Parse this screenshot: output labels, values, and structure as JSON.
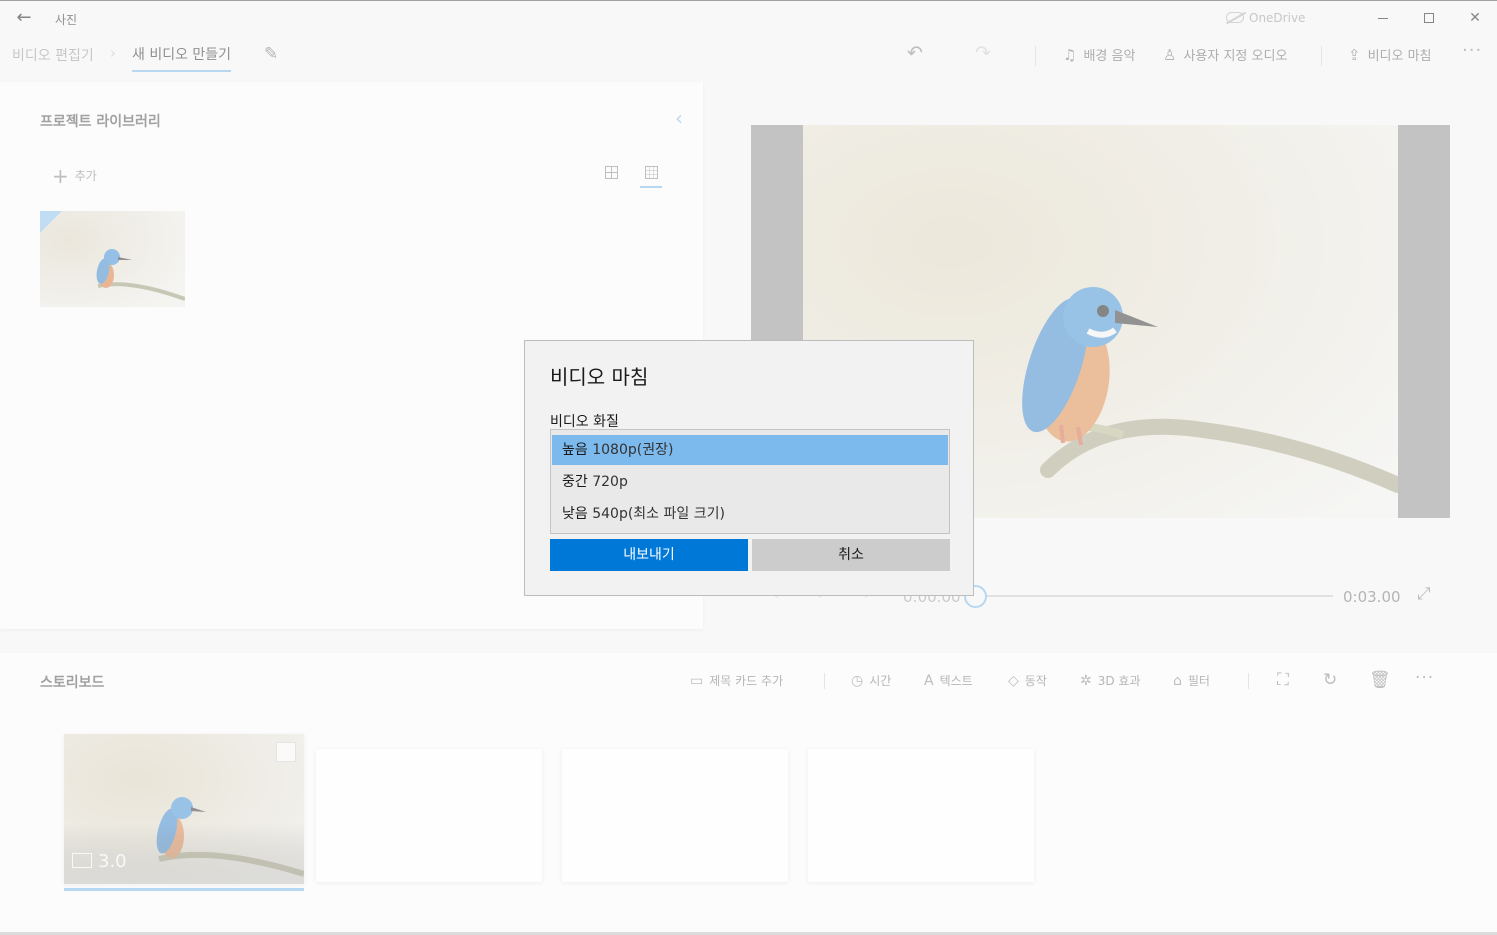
{
  "app": {
    "title": "사진",
    "onedrive_label": "OneDrive"
  },
  "breadcrumb": {
    "root": "비디오 편집기",
    "current": "새 비디오 만들기"
  },
  "toolbar": {
    "background_music": "배경 음악",
    "custom_audio": "사용자 지정 오디오",
    "finish_video": "비디오 마침"
  },
  "library": {
    "title": "프로젝트 라이브러리",
    "add_label": "추가"
  },
  "player": {
    "current_time": "0:00.00",
    "end_time": "0:03.00",
    "position_fraction": 0
  },
  "storyboard": {
    "title": "스토리보드",
    "tools": {
      "title_card": "제목 카드 추가",
      "duration": "시간",
      "text": "텍스트",
      "motion": "동작",
      "effects_3d": "3D 효과",
      "filters": "필터"
    },
    "clips": [
      {
        "duration": "3.0",
        "selected": true
      }
    ]
  },
  "dialog": {
    "title": "비디오 마침",
    "quality_label": "비디오 화질",
    "options": [
      {
        "name": "높음",
        "detail": "1080p(권장)",
        "selected": true
      },
      {
        "name": "중간",
        "detail": "720p",
        "selected": false
      },
      {
        "name": "낮음",
        "detail": "540p(최소 파일 크기)",
        "selected": false
      }
    ],
    "export_button": "내보내기",
    "cancel_button": "취소"
  },
  "colors": {
    "accent": "#0078d7",
    "selection": "#7cb9ec",
    "focus_underline": "#7fb7e6"
  }
}
